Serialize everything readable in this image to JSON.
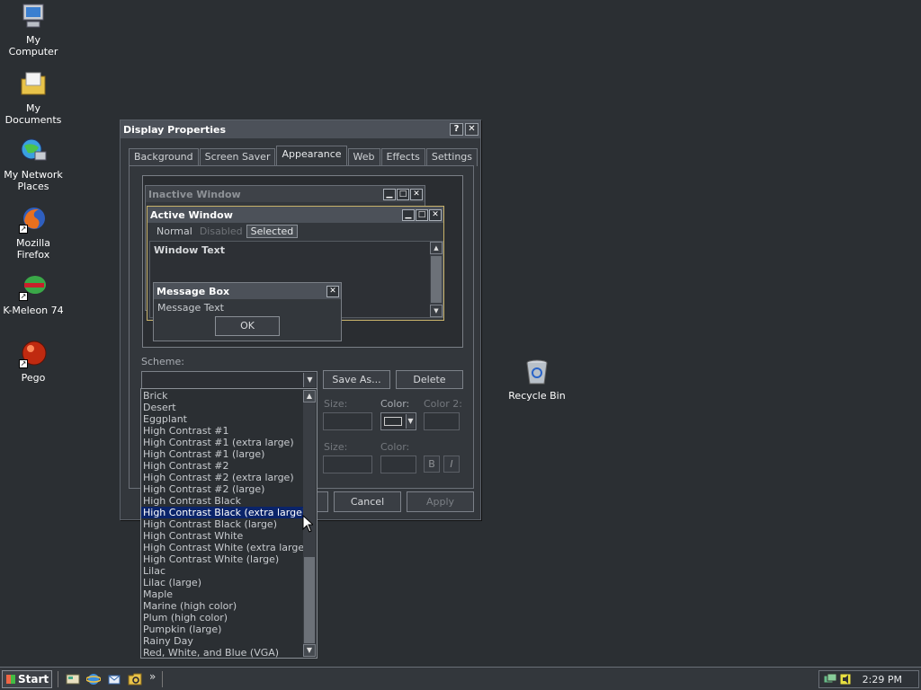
{
  "desktop": {
    "icons": [
      {
        "label": "My Computer"
      },
      {
        "label": "My Documents"
      },
      {
        "label": "My Network Places"
      },
      {
        "label": "Mozilla Firefox"
      },
      {
        "label": "K-Meleon 74"
      },
      {
        "label": "Pego"
      },
      {
        "label": "Recycle Bin"
      }
    ]
  },
  "window": {
    "title": "Display Properties",
    "help_glyph": "?",
    "close_glyph": "✕",
    "tabs": [
      "Background",
      "Screen Saver",
      "Appearance",
      "Web",
      "Effects",
      "Settings"
    ],
    "active_tab": "Appearance"
  },
  "preview": {
    "inactive_title": "Inactive Window",
    "active_title": "Active Window",
    "menu": [
      "Normal",
      "Disabled",
      "Selected"
    ],
    "window_text": "Window Text",
    "message_title": "Message Box",
    "message_text": "Message Text",
    "ok_label": "OK",
    "min_glyph": "▁",
    "max_glyph": "□",
    "close_glyph": "✕"
  },
  "scheme": {
    "label": "Scheme:",
    "save_as_label": "Save As...",
    "delete_label": "Delete",
    "size_label": "Size:",
    "color_label": "Color:",
    "color2_label": "Color 2:",
    "size_label_2": "Size:",
    "color_label_2": "Color:",
    "bold_label": "B",
    "italic_label": "I",
    "options": [
      "Brick",
      "Desert",
      "Eggplant",
      "High Contrast #1",
      "High Contrast #1 (extra large)",
      "High Contrast #1 (large)",
      "High Contrast #2",
      "High Contrast #2 (extra large)",
      "High Contrast #2 (large)",
      "High Contrast Black",
      "High Contrast Black (extra large)",
      "High Contrast Black (large)",
      "High Contrast White",
      "High Contrast White (extra large)",
      "High Contrast White (large)",
      "Lilac",
      "Lilac (large)",
      "Maple",
      "Marine (high color)",
      "Plum (high color)",
      "Pumpkin (large)",
      "Rainy Day",
      "Red, White, and Blue (VGA)"
    ],
    "selected_index": 10
  },
  "footer": {
    "cancel_label": "Cancel",
    "apply_label": "Apply"
  },
  "taskbar": {
    "start_label": "Start",
    "chevron": "»",
    "clock": "2:29 PM"
  },
  "colors": {
    "desktop": "#2b2f33",
    "selection": "#0a246a",
    "active_title": "#4c5159"
  }
}
